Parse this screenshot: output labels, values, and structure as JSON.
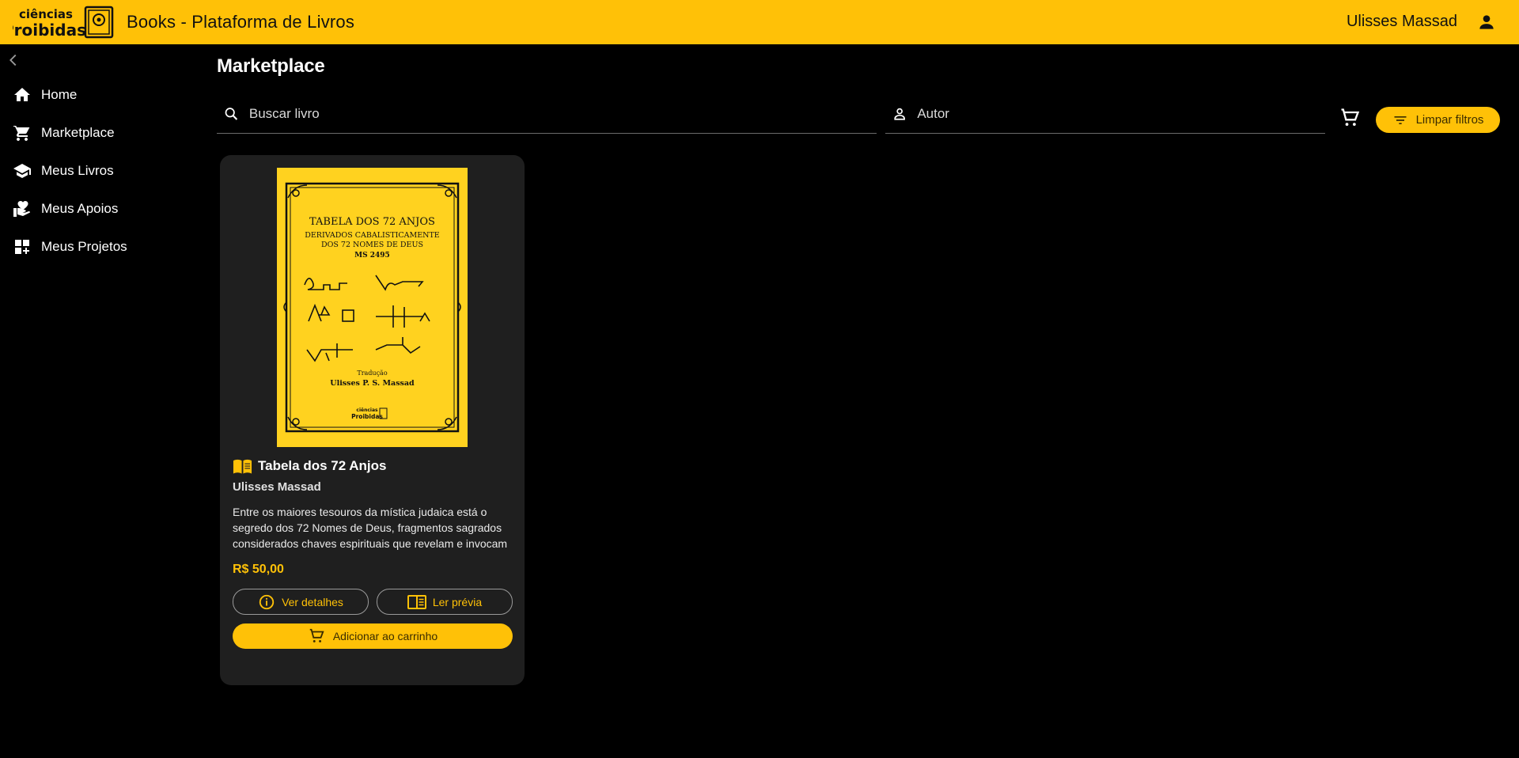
{
  "header": {
    "logo_text_line1": "ciências",
    "logo_text_line2": "Proibidas",
    "title": "Books - Plataforma de Livros",
    "user_name": "Ulisses Massad",
    "background_color": "#ffc107"
  },
  "sidebar": {
    "collapse_icon": "chevron-left-icon",
    "items": [
      {
        "label": "Home",
        "icon": "home-icon"
      },
      {
        "label": "Marketplace",
        "icon": "cart-icon"
      },
      {
        "label": "Meus Livros",
        "icon": "school-icon"
      },
      {
        "label": "Meus Apoios",
        "icon": "volunteer-icon"
      },
      {
        "label": "Meus Projetos",
        "icon": "dashboard-add-icon"
      }
    ]
  },
  "main": {
    "page_title": "Marketplace",
    "search": {
      "placeholder": "Buscar livro",
      "value": ""
    },
    "author": {
      "placeholder": "Autor",
      "value": ""
    },
    "clear_filters_label": "Limpar filtros",
    "accent_color": "#ffc107"
  },
  "books": [
    {
      "title": "Tabela dos 72 Anjos",
      "author": "Ulisses Massad",
      "description": "Entre os maiores tesouros da mística judaica está o segredo dos 72 Nomes de Deus, fragmentos sagrados considerados chaves espirituais que revelam e invocam",
      "price": "R$ 50,00",
      "details_label": "Ver detalhes",
      "preview_label": "Ler prévia",
      "add_to_cart_label": "Adicionar ao carrinho",
      "cover": {
        "title_line1": "TABELA DOS 72 ANJOS",
        "title_line2": "DERIVADOS  CABALISTICAMENTE",
        "title_line3": "DOS 72 NOMES DE DEUS",
        "title_line4": "MS 2495",
        "translation_label": "Tradução",
        "translator": "Ulisses P. S. Massad",
        "publisher_line1": "ciências",
        "publisher_line2": "Proibidas"
      }
    }
  ]
}
